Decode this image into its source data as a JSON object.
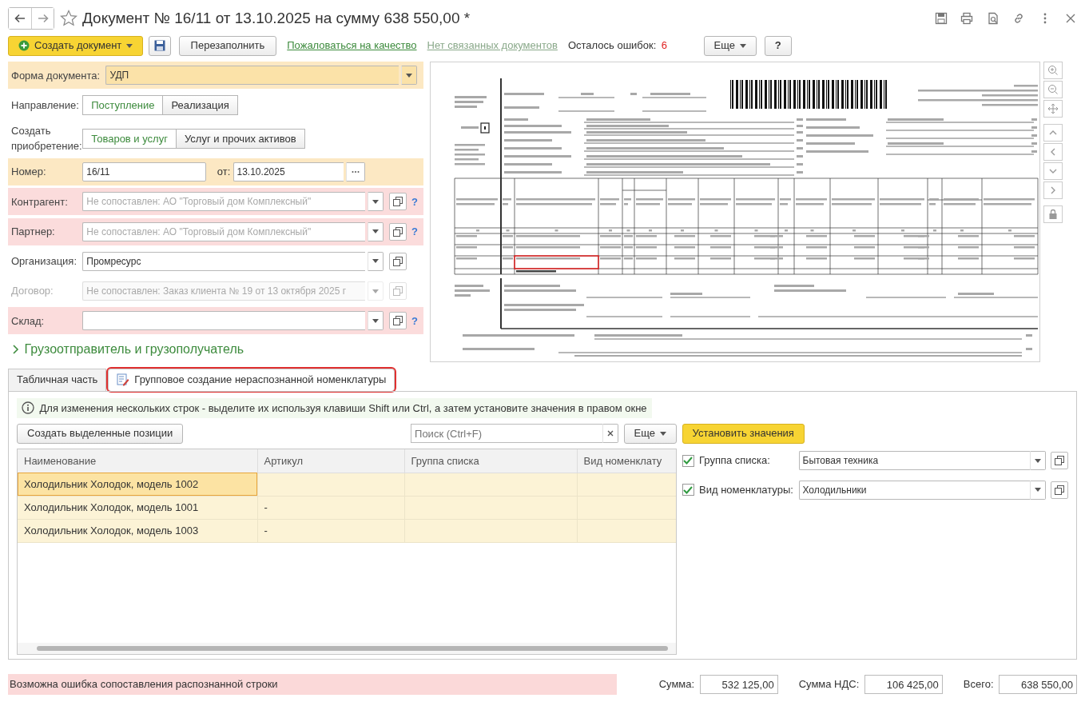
{
  "window": {
    "title": "Документ № 16/11 от 13.10.2025 на сумму 638 550,00 *",
    "favorite": false
  },
  "toolbar": {
    "create": "Создать документ",
    "refill": "Перезаполнить",
    "complain": "Пожаловаться на качество",
    "related": "Нет связанных документов",
    "errors_label": "Осталось ошибок:",
    "errors_count": "6",
    "more": "Еще",
    "help": "?"
  },
  "form": [
    {
      "kind": "select",
      "label": "Форма документа:",
      "value": "УДП",
      "highlight": true
    },
    {
      "kind": "toggle",
      "label": "Направление:",
      "options": [
        {
          "label": "Поступление",
          "selected": true
        },
        {
          "label": "Реализация",
          "selected": false
        }
      ]
    },
    {
      "kind": "toggle",
      "label": "Создать приобретение:",
      "options": [
        {
          "label": "Товаров и услуг",
          "selected": true
        },
        {
          "label": "Услуг и прочих активов",
          "selected": false
        }
      ]
    },
    {
      "kind": "number",
      "label": "Номер:",
      "value": "16/11",
      "date_label": "от:",
      "date": "13.10.2025",
      "highlight": true
    },
    {
      "kind": "ref",
      "label": "Контрагент:",
      "placeholder": "Не сопоставлен: АО \"Торговый дом Комплексный\"",
      "error": true,
      "help": "?"
    },
    {
      "kind": "ref",
      "label": "Партнер:",
      "placeholder": "Не сопоставлен: АО \"Торговый дом Комплексный\"",
      "error": true,
      "help": "?"
    },
    {
      "kind": "ref",
      "label": "Организация:",
      "value": "Промресурс",
      "error": false
    },
    {
      "kind": "ref",
      "label": "Договор:",
      "placeholder": "Не сопоставлен: Заказ клиента № 19 от 13 октября 2025 г",
      "error": false,
      "disabled": true
    },
    {
      "kind": "ref",
      "label": "Склад:",
      "error": true,
      "help": "?"
    }
  ],
  "section": {
    "label": "Грузоотправитель и грузополучатель",
    "expanded": false
  },
  "tabs": [
    {
      "label": "Табличная часть",
      "selected": false
    },
    {
      "label": "Групповое создание нераспознанной номенклатуры",
      "selected": true
    }
  ],
  "info": "Для изменения нескольких строк - выделите их используя клавиши Shift или Ctrl, а затем установите значения в правом окне",
  "actions": {
    "create_selected": "Создать выделенные позиции",
    "search_placeholder": "Поиск (Ctrl+F)",
    "more": "Еще",
    "apply": "Установить значения"
  },
  "grid": {
    "columns": [
      "Наименование",
      "Артикул",
      "Группа списка",
      "Вид номенклату"
    ],
    "rows": [
      {
        "name": "Холодильник Холодок, модель 1002",
        "selected": true
      },
      {
        "name": "Холодильник Холодок, модель 1001",
        "article": "-",
        "selected": false
      },
      {
        "name": "Холодильник Холодок, модель 1003",
        "article": "-",
        "selected": false
      }
    ]
  },
  "settings": [
    {
      "label": "Группа списка:",
      "value": "Бытовая техника",
      "checked": true
    },
    {
      "label": "Вид номенклатуры:",
      "value": "Холодильники",
      "checked": true
    }
  ],
  "warning": "Возможна ошибка сопоставления распознанной строки",
  "totals": [
    {
      "label": "Сумма:",
      "value": "532 125,00"
    },
    {
      "label": "Сумма НДС:",
      "value": "106 425,00"
    },
    {
      "label": "Всего:",
      "value": "638 550,00"
    }
  ]
}
